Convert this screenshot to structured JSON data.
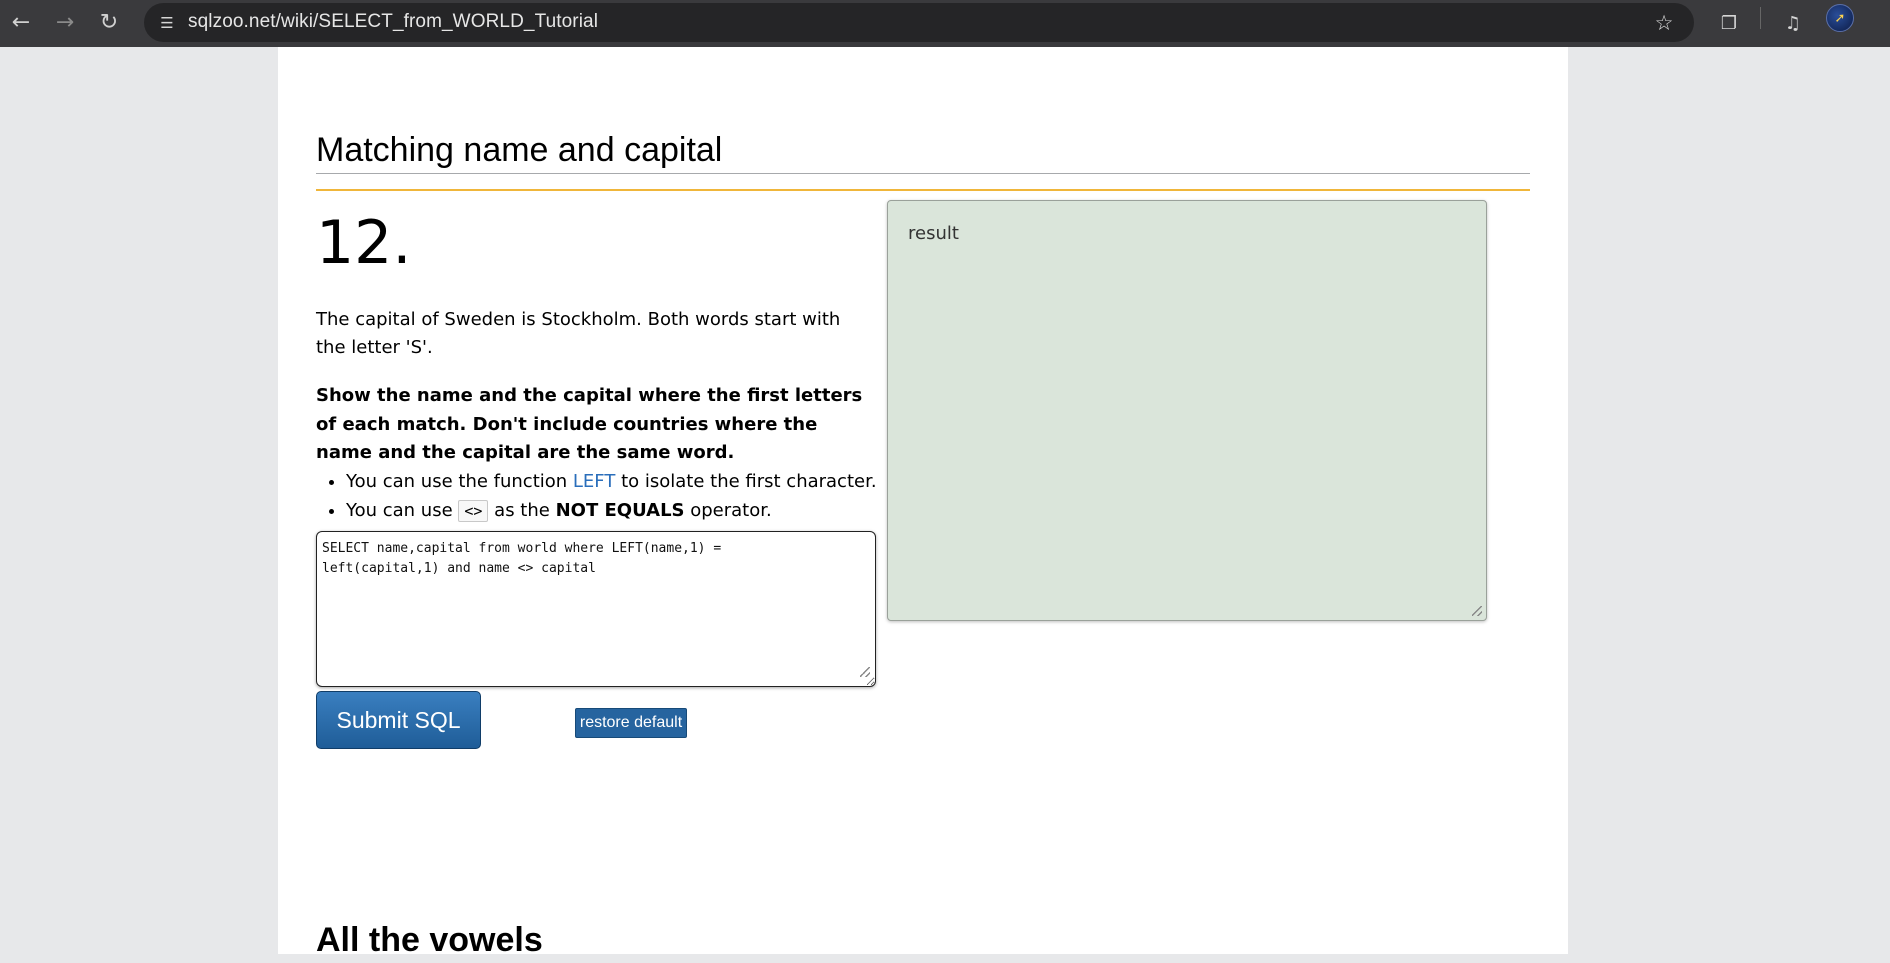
{
  "browser": {
    "back_icon": "arrow-left-icon",
    "forward_icon": "arrow-right-icon",
    "reload_icon": "reload-icon",
    "url": "sqlzoo.net/wiki/SELECT_from_WORLD_Tutorial"
  },
  "section": {
    "title": "Matching name and capital",
    "number": "12.",
    "intro": "The capital of Sweden is Stockholm. Both words start with the letter 'S'.",
    "task": "Show the name and the capital where the first letters of each match. Don't include countries where the name and the capital are the same word.",
    "hints": {
      "hint1_prefix": "You can use the function ",
      "hint1_link": "LEFT",
      "hint1_suffix": " to isolate the first character.",
      "hint2_prefix": "You can use ",
      "hint2_code": "<>",
      "hint2_middle": " as the ",
      "hint2_bold": "NOT EQUALS",
      "hint2_suffix": " operator."
    }
  },
  "editor": {
    "value": "SELECT name,capital from world where LEFT(name,1) =\nleft(capital,1) and name <> capital"
  },
  "buttons": {
    "submit": "Submit SQL",
    "restore": "restore default"
  },
  "result": {
    "label": "result"
  },
  "next_section": {
    "title": "All the vowels"
  }
}
